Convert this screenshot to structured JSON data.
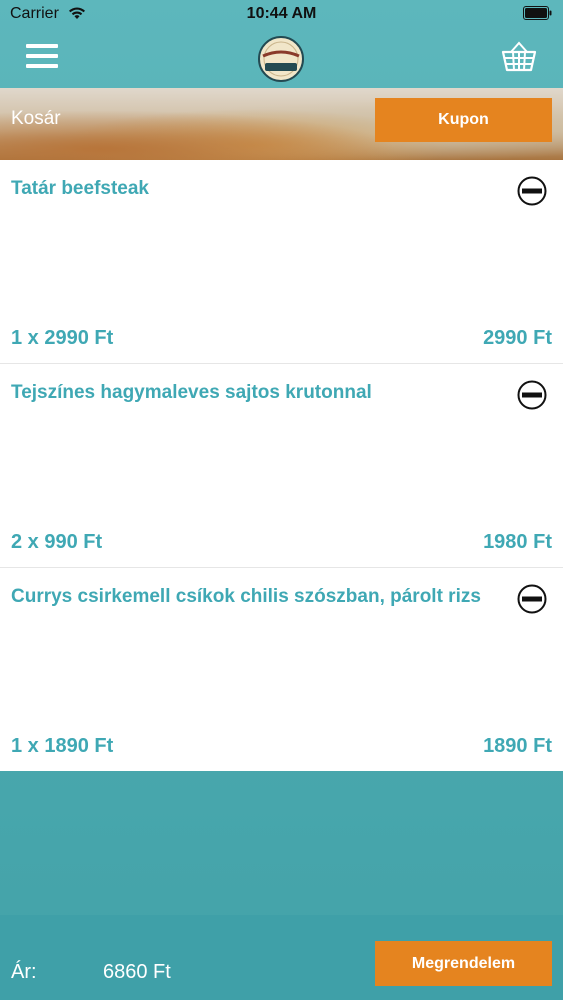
{
  "status_bar": {
    "carrier": "Carrier",
    "time": "10:44 AM",
    "wifi_icon": "wifi-icon",
    "battery_icon": "battery-icon"
  },
  "nav": {
    "menu_icon": "hamburger-menu-icon",
    "logo_icon": "restaurant-logo",
    "basket_icon": "shopping-basket-icon"
  },
  "banner": {
    "title": "Kosár",
    "coupon_label": "Kupon"
  },
  "cart": {
    "items": [
      {
        "name": "Tatár beefsteak",
        "qty_price": "1 x 2990 Ft",
        "total": "2990 Ft"
      },
      {
        "name": "Tejszínes hagymaleves sajtos krutonnal",
        "qty_price": "2 x 990 Ft",
        "total": "1980 Ft"
      },
      {
        "name": "Currys csirkemell csíkok chilis szószban, párolt rizs",
        "qty_price": "1 x 1890 Ft",
        "total": "1890 Ft"
      }
    ]
  },
  "footer": {
    "price_label": "Ár:",
    "price_value": "6860 Ft",
    "order_label": "Megrendelem"
  },
  "colors": {
    "accent_teal": "#3fa8b4",
    "button_orange": "#e5841f",
    "background_teal": "#4aa9af"
  }
}
